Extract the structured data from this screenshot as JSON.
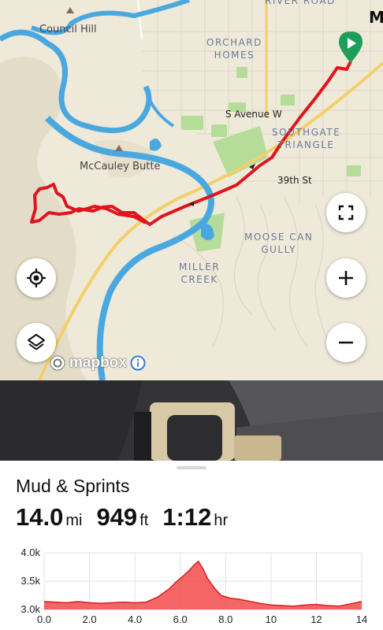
{
  "map": {
    "labels": {
      "river_road": "RIVER ROAD",
      "council_hill": "Council Hill",
      "orchard_homes": [
        "ORCHARD",
        "HOMES"
      ],
      "s_avenue_w": "S Avenue W",
      "southgate": [
        "SOUTHGATE",
        "TRIANGLE"
      ],
      "mccauley_butte": "McCauley Butte",
      "st_39th": "39th St",
      "moose_can_gully": [
        "MOOSE CAN",
        "GULLY"
      ],
      "miller_creek": [
        "MILLER",
        "CREEK"
      ],
      "edge_letter": "M"
    },
    "attribution": "mapbox",
    "colors": {
      "route": "#e0141c",
      "river": "#4aa8e0",
      "park": "#b6dc9a",
      "start_marker": "#1f9d5a",
      "terrain": "#efe9d9"
    },
    "controls": {
      "fullscreen_icon": "fullscreen-icon",
      "locate_icon": "locate-icon",
      "layers_icon": "layers-icon",
      "zoom_in_icon": "plus-icon",
      "zoom_out_icon": "minus-icon"
    }
  },
  "route": {
    "title": "Mud & Sprints",
    "distance": {
      "value": "14.0",
      "unit": "mi"
    },
    "elevation_gain": {
      "value": "949",
      "unit": "ft"
    },
    "duration": {
      "value": "1:12",
      "unit": "hr"
    }
  },
  "chart_data": {
    "type": "area",
    "title": "",
    "xlabel": "",
    "ylabel": "",
    "xlim": [
      0,
      14
    ],
    "ylim": [
      3.0,
      4.0
    ],
    "x_ticks": [
      "0.0",
      "2.0",
      "4.0",
      "6.0",
      "8.0",
      "10",
      "12",
      "14"
    ],
    "y_ticks": [
      "4.0k",
      "3.5k",
      "3.0k"
    ],
    "series": [
      {
        "color": "#f24a4a",
        "x": [
          0,
          0.5,
          1,
          1.5,
          2,
          2.5,
          3,
          3.5,
          4,
          4.5,
          5,
          5.5,
          5.8,
          6.1,
          6.4,
          6.6,
          6.8,
          7.0,
          7.2,
          7.5,
          7.8,
          8.2,
          8.6,
          9,
          9.5,
          10,
          10.5,
          11,
          11.5,
          12,
          12.5,
          13,
          13.5,
          14
        ],
        "y": [
          3.14,
          3.13,
          3.12,
          3.14,
          3.12,
          3.11,
          3.12,
          3.13,
          3.12,
          3.13,
          3.22,
          3.36,
          3.48,
          3.58,
          3.69,
          3.78,
          3.85,
          3.72,
          3.55,
          3.38,
          3.25,
          3.2,
          3.18,
          3.15,
          3.11,
          3.08,
          3.07,
          3.06,
          3.08,
          3.09,
          3.07,
          3.06,
          3.1,
          3.14
        ]
      }
    ],
    "grid": true,
    "legend": "none"
  }
}
